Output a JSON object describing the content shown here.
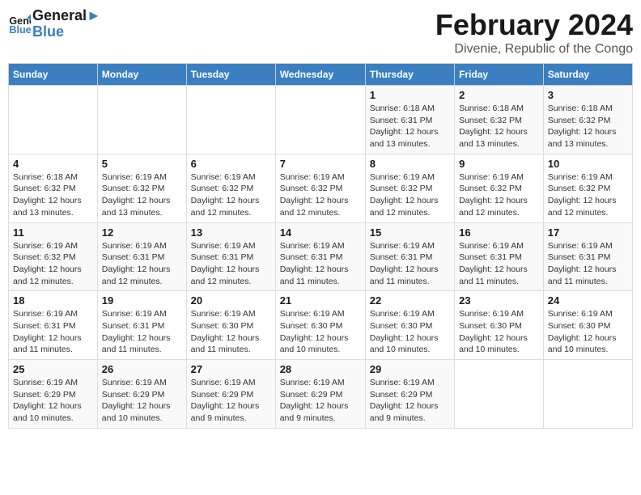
{
  "header": {
    "logo_line1": "General",
    "logo_line2": "Blue",
    "month": "February 2024",
    "location": "Divenie, Republic of the Congo"
  },
  "days_of_week": [
    "Sunday",
    "Monday",
    "Tuesday",
    "Wednesday",
    "Thursday",
    "Friday",
    "Saturday"
  ],
  "weeks": [
    [
      {
        "num": "",
        "info": ""
      },
      {
        "num": "",
        "info": ""
      },
      {
        "num": "",
        "info": ""
      },
      {
        "num": "",
        "info": ""
      },
      {
        "num": "1",
        "info": "Sunrise: 6:18 AM\nSunset: 6:31 PM\nDaylight: 12 hours\nand 13 minutes."
      },
      {
        "num": "2",
        "info": "Sunrise: 6:18 AM\nSunset: 6:32 PM\nDaylight: 12 hours\nand 13 minutes."
      },
      {
        "num": "3",
        "info": "Sunrise: 6:18 AM\nSunset: 6:32 PM\nDaylight: 12 hours\nand 13 minutes."
      }
    ],
    [
      {
        "num": "4",
        "info": "Sunrise: 6:18 AM\nSunset: 6:32 PM\nDaylight: 12 hours\nand 13 minutes."
      },
      {
        "num": "5",
        "info": "Sunrise: 6:19 AM\nSunset: 6:32 PM\nDaylight: 12 hours\nand 13 minutes."
      },
      {
        "num": "6",
        "info": "Sunrise: 6:19 AM\nSunset: 6:32 PM\nDaylight: 12 hours\nand 12 minutes."
      },
      {
        "num": "7",
        "info": "Sunrise: 6:19 AM\nSunset: 6:32 PM\nDaylight: 12 hours\nand 12 minutes."
      },
      {
        "num": "8",
        "info": "Sunrise: 6:19 AM\nSunset: 6:32 PM\nDaylight: 12 hours\nand 12 minutes."
      },
      {
        "num": "9",
        "info": "Sunrise: 6:19 AM\nSunset: 6:32 PM\nDaylight: 12 hours\nand 12 minutes."
      },
      {
        "num": "10",
        "info": "Sunrise: 6:19 AM\nSunset: 6:32 PM\nDaylight: 12 hours\nand 12 minutes."
      }
    ],
    [
      {
        "num": "11",
        "info": "Sunrise: 6:19 AM\nSunset: 6:32 PM\nDaylight: 12 hours\nand 12 minutes."
      },
      {
        "num": "12",
        "info": "Sunrise: 6:19 AM\nSunset: 6:31 PM\nDaylight: 12 hours\nand 12 minutes."
      },
      {
        "num": "13",
        "info": "Sunrise: 6:19 AM\nSunset: 6:31 PM\nDaylight: 12 hours\nand 12 minutes."
      },
      {
        "num": "14",
        "info": "Sunrise: 6:19 AM\nSunset: 6:31 PM\nDaylight: 12 hours\nand 11 minutes."
      },
      {
        "num": "15",
        "info": "Sunrise: 6:19 AM\nSunset: 6:31 PM\nDaylight: 12 hours\nand 11 minutes."
      },
      {
        "num": "16",
        "info": "Sunrise: 6:19 AM\nSunset: 6:31 PM\nDaylight: 12 hours\nand 11 minutes."
      },
      {
        "num": "17",
        "info": "Sunrise: 6:19 AM\nSunset: 6:31 PM\nDaylight: 12 hours\nand 11 minutes."
      }
    ],
    [
      {
        "num": "18",
        "info": "Sunrise: 6:19 AM\nSunset: 6:31 PM\nDaylight: 12 hours\nand 11 minutes."
      },
      {
        "num": "19",
        "info": "Sunrise: 6:19 AM\nSunset: 6:31 PM\nDaylight: 12 hours\nand 11 minutes."
      },
      {
        "num": "20",
        "info": "Sunrise: 6:19 AM\nSunset: 6:30 PM\nDaylight: 12 hours\nand 11 minutes."
      },
      {
        "num": "21",
        "info": "Sunrise: 6:19 AM\nSunset: 6:30 PM\nDaylight: 12 hours\nand 10 minutes."
      },
      {
        "num": "22",
        "info": "Sunrise: 6:19 AM\nSunset: 6:30 PM\nDaylight: 12 hours\nand 10 minutes."
      },
      {
        "num": "23",
        "info": "Sunrise: 6:19 AM\nSunset: 6:30 PM\nDaylight: 12 hours\nand 10 minutes."
      },
      {
        "num": "24",
        "info": "Sunrise: 6:19 AM\nSunset: 6:30 PM\nDaylight: 12 hours\nand 10 minutes."
      }
    ],
    [
      {
        "num": "25",
        "info": "Sunrise: 6:19 AM\nSunset: 6:29 PM\nDaylight: 12 hours\nand 10 minutes."
      },
      {
        "num": "26",
        "info": "Sunrise: 6:19 AM\nSunset: 6:29 PM\nDaylight: 12 hours\nand 10 minutes."
      },
      {
        "num": "27",
        "info": "Sunrise: 6:19 AM\nSunset: 6:29 PM\nDaylight: 12 hours\nand 9 minutes."
      },
      {
        "num": "28",
        "info": "Sunrise: 6:19 AM\nSunset: 6:29 PM\nDaylight: 12 hours\nand 9 minutes."
      },
      {
        "num": "29",
        "info": "Sunrise: 6:19 AM\nSunset: 6:29 PM\nDaylight: 12 hours\nand 9 minutes."
      },
      {
        "num": "",
        "info": ""
      },
      {
        "num": "",
        "info": ""
      }
    ]
  ]
}
